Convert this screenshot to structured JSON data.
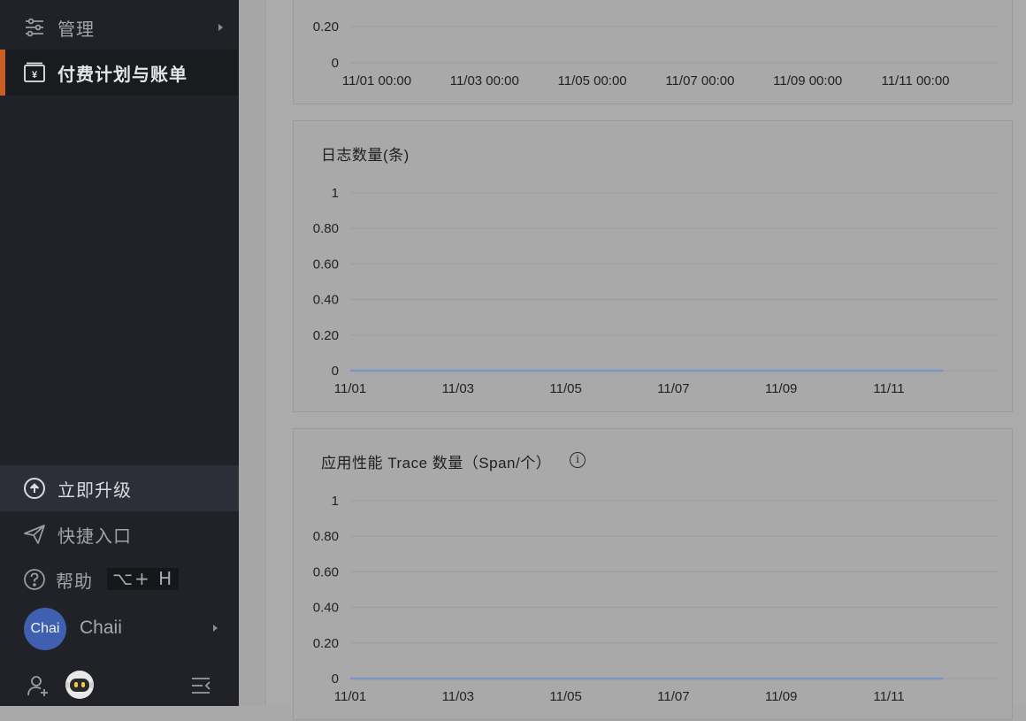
{
  "sidebar": {
    "items": [
      {
        "label": "管理",
        "icon": "sliders-icon"
      },
      {
        "label": "付费计划与账单",
        "icon": "billing-icon"
      }
    ],
    "upgrade": {
      "label": "立即升级",
      "icon": "upload-circle-icon"
    },
    "shortcut": {
      "label": "快捷入口",
      "icon": "paper-plane-icon"
    },
    "help": {
      "label": "帮助",
      "shortcut_key": "⌥+ H",
      "icon": "question-circle-icon"
    },
    "user": {
      "avatar_text": "Chai",
      "name": "Chaii"
    },
    "bottom_icons": [
      "add-user-icon",
      "robot-assistant-icon",
      "collapse-menu-icon"
    ]
  },
  "colors": {
    "accent": "#c95f24",
    "avatar": "#3f5fb0",
    "series_line": "#7b93c2"
  },
  "chart_data": [
    {
      "type": "line",
      "title": "",
      "y_ticks": [
        "0.20",
        "0"
      ],
      "x_ticks": [
        "11/01 00:00",
        "11/03 00:00",
        "11/05 00:00",
        "11/07 00:00",
        "11/09 00:00",
        "11/11 00:00"
      ],
      "partially_visible": true
    },
    {
      "type": "line",
      "title": "日志数量(条)",
      "y_ticks": [
        "1",
        "0.80",
        "0.60",
        "0.40",
        "0.20",
        "0"
      ],
      "ylim": [
        0,
        1
      ],
      "x_ticks": [
        "11/01",
        "11/03",
        "11/05",
        "11/07",
        "11/09",
        "11/11"
      ],
      "series": [
        {
          "values": [
            0,
            0,
            0,
            0,
            0,
            0,
            0,
            0,
            0,
            0,
            0,
            0
          ]
        }
      ],
      "grid": true
    },
    {
      "type": "line",
      "title": "应用性能 Trace 数量（Span/个）",
      "y_ticks": [
        "1",
        "0.80",
        "0.60",
        "0.40",
        "0.20",
        "0"
      ],
      "ylim": [
        0,
        1
      ],
      "x_ticks": [
        "11/01",
        "11/03",
        "11/05",
        "11/07",
        "11/09",
        "11/11"
      ],
      "series": [
        {
          "values": [
            0,
            0,
            0,
            0,
            0,
            0,
            0,
            0,
            0,
            0,
            0,
            0
          ]
        }
      ],
      "grid": true,
      "info_icon": "info-circle-icon"
    }
  ]
}
